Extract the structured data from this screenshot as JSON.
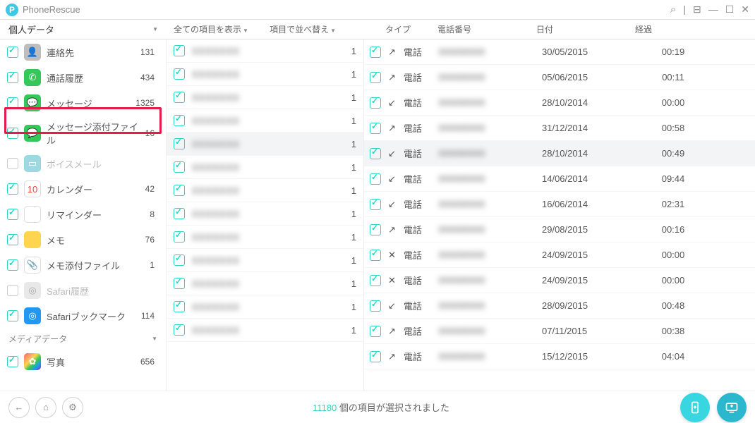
{
  "app": {
    "title": "PhoneRescue"
  },
  "header": {
    "group_personal": "個人データ",
    "col_showall": "全ての項目を表示",
    "col_sort": "項目で並べ替え",
    "col_type": "タイプ",
    "col_phone": "電話番号",
    "col_date": "日付",
    "col_duration": "経過"
  },
  "sidebar": {
    "items": [
      {
        "label": "連絡先",
        "count": 131,
        "checked": true,
        "icon": "ico-contacts",
        "glyph": "👤"
      },
      {
        "label": "通話履歴",
        "count": 434,
        "checked": true,
        "icon": "ico-call",
        "glyph": "✆"
      },
      {
        "label": "メッセージ",
        "count": 1325,
        "checked": true,
        "icon": "ico-msg",
        "glyph": "💬"
      },
      {
        "label": "メッセージ添付ファイル",
        "count": 16,
        "checked": true,
        "icon": "ico-attach",
        "glyph": "💬"
      },
      {
        "label": "ボイスメール",
        "count": "",
        "checked": false,
        "disabled": true,
        "icon": "ico-voice",
        "glyph": "▭"
      },
      {
        "label": "カレンダー",
        "count": 42,
        "checked": true,
        "icon": "ico-cal",
        "glyph": "10"
      },
      {
        "label": "リマインダー",
        "count": 8,
        "checked": true,
        "icon": "ico-rem",
        "glyph": "≡"
      },
      {
        "label": "メモ",
        "count": 76,
        "checked": true,
        "icon": "ico-note",
        "glyph": ""
      },
      {
        "label": "メモ添付ファイル",
        "count": 1,
        "checked": true,
        "icon": "ico-noteatt",
        "glyph": "📎"
      },
      {
        "label": "Safari履歴",
        "count": "",
        "checked": false,
        "disabled": true,
        "icon": "ico-safari",
        "glyph": "◎"
      },
      {
        "label": "Safariブックマーク",
        "count": 114,
        "checked": true,
        "icon": "ico-bookmark",
        "glyph": "◎"
      }
    ],
    "group_media": "メディアデータ",
    "media_items": [
      {
        "label": "写真",
        "count": 656,
        "checked": true,
        "icon": "ico-photo",
        "glyph": "✿"
      }
    ]
  },
  "middle": {
    "rows": [
      {
        "count": 1,
        "sel": false
      },
      {
        "count": 1,
        "sel": false
      },
      {
        "count": 1,
        "sel": false
      },
      {
        "count": 1,
        "sel": false
      },
      {
        "count": 1,
        "sel": true
      },
      {
        "count": 1,
        "sel": false
      },
      {
        "count": 1,
        "sel": false
      },
      {
        "count": 1,
        "sel": false
      },
      {
        "count": 1,
        "sel": false
      },
      {
        "count": 1,
        "sel": false
      },
      {
        "count": 1,
        "sel": false
      },
      {
        "count": 1,
        "sel": false
      },
      {
        "count": 1,
        "sel": false
      }
    ]
  },
  "right": {
    "type_label": "電話",
    "rows": [
      {
        "dir": "out",
        "date": "30/05/2015",
        "dur": "00:19",
        "sel": false
      },
      {
        "dir": "out",
        "date": "05/06/2015",
        "dur": "00:11",
        "sel": false
      },
      {
        "dir": "in",
        "date": "28/10/2014",
        "dur": "00:00",
        "sel": false
      },
      {
        "dir": "out",
        "date": "31/12/2014",
        "dur": "00:58",
        "sel": false
      },
      {
        "dir": "in",
        "date": "28/10/2014",
        "dur": "00:49",
        "sel": true
      },
      {
        "dir": "in",
        "date": "14/06/2014",
        "dur": "09:44",
        "sel": false
      },
      {
        "dir": "in",
        "date": "16/06/2014",
        "dur": "02:31",
        "sel": false
      },
      {
        "dir": "out",
        "date": "29/08/2015",
        "dur": "00:16",
        "sel": false
      },
      {
        "dir": "miss",
        "date": "24/09/2015",
        "dur": "00:00",
        "sel": false
      },
      {
        "dir": "miss",
        "date": "24/09/2015",
        "dur": "00:00",
        "sel": false
      },
      {
        "dir": "in",
        "date": "28/09/2015",
        "dur": "00:48",
        "sel": false
      },
      {
        "dir": "out",
        "date": "07/11/2015",
        "dur": "00:38",
        "sel": false
      },
      {
        "dir": "out",
        "date": "15/12/2015",
        "dur": "04:04",
        "sel": false
      }
    ]
  },
  "footer": {
    "count": "11180",
    "suffix": " 個の項目が選択されました"
  }
}
